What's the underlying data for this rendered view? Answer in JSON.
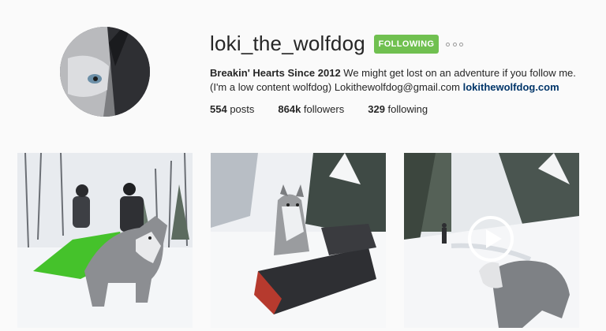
{
  "profile": {
    "username": "loki_the_wolfdog",
    "follow_label": "FOLLOWING",
    "bio_name": "Breakin' Hearts Since 2012",
    "bio_text_1": " We might get lost on an adventure if you follow me.",
    "bio_text_2": "(I'm a low content wolfdog) Lokithewolfdog@gmail.com ",
    "website": "lokithewolfdog.com"
  },
  "stats": {
    "posts_count": "554",
    "posts_label": " posts",
    "followers_count": "864k",
    "followers_label": " followers",
    "following_count": "329",
    "following_label": " following"
  },
  "posts": [
    {
      "kind": "photo"
    },
    {
      "kind": "photo"
    },
    {
      "kind": "video",
      "icon": "play-icon"
    }
  ],
  "colors": {
    "follow_button": "#70c050",
    "link": "#003569",
    "background": "#fafafa"
  }
}
